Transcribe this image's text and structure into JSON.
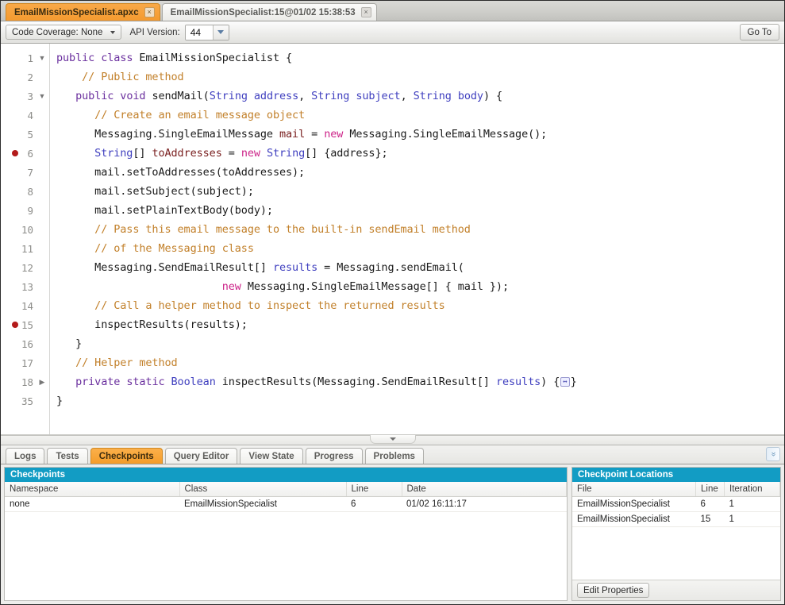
{
  "tabs": [
    {
      "label": "EmailMissionSpecialist.apxc",
      "active": true,
      "close": "×"
    },
    {
      "label": "EmailMissionSpecialist:15@01/02 15:38:53",
      "active": false,
      "close": "×"
    }
  ],
  "toolbar": {
    "code_coverage_label": "Code Coverage: None",
    "api_version_label": "API Version:",
    "api_version_value": "44",
    "goto_label": "Go To"
  },
  "editor": {
    "lines": [
      {
        "num": "1",
        "fold": "down",
        "breakpoint": false,
        "tokens": [
          {
            "t": "public",
            "c": "kw"
          },
          {
            "t": " ",
            "c": "pln"
          },
          {
            "t": "class",
            "c": "kw"
          },
          {
            "t": " EmailMissionSpecialist {",
            "c": "pln"
          }
        ]
      },
      {
        "num": "2",
        "fold": "",
        "breakpoint": false,
        "tokens": [
          {
            "t": "    // Public method",
            "c": "cmt"
          }
        ]
      },
      {
        "num": "3",
        "fold": "down",
        "breakpoint": false,
        "tokens": [
          {
            "t": "   ",
            "c": "pln"
          },
          {
            "t": "public",
            "c": "kw"
          },
          {
            "t": " ",
            "c": "pln"
          },
          {
            "t": "void",
            "c": "kw"
          },
          {
            "t": " sendMail(",
            "c": "pln"
          },
          {
            "t": "String",
            "c": "typ"
          },
          {
            "t": " ",
            "c": "pln"
          },
          {
            "t": "address",
            "c": "typ"
          },
          {
            "t": ", ",
            "c": "pln"
          },
          {
            "t": "String",
            "c": "typ"
          },
          {
            "t": " ",
            "c": "pln"
          },
          {
            "t": "subject",
            "c": "typ"
          },
          {
            "t": ", ",
            "c": "pln"
          },
          {
            "t": "String",
            "c": "typ"
          },
          {
            "t": " ",
            "c": "pln"
          },
          {
            "t": "body",
            "c": "typ"
          },
          {
            "t": ") {",
            "c": "pln"
          }
        ]
      },
      {
        "num": "4",
        "fold": "",
        "breakpoint": false,
        "tokens": [
          {
            "t": "      // Create an email message object",
            "c": "cmt"
          }
        ]
      },
      {
        "num": "5",
        "fold": "",
        "breakpoint": false,
        "tokens": [
          {
            "t": "      Messaging.SingleEmailMessage ",
            "c": "pln"
          },
          {
            "t": "mail",
            "c": "var"
          },
          {
            "t": " = ",
            "c": "pln"
          },
          {
            "t": "new",
            "c": "new"
          },
          {
            "t": " Messaging.SingleEmailMessage();",
            "c": "pln"
          }
        ]
      },
      {
        "num": "6",
        "fold": "",
        "breakpoint": true,
        "tokens": [
          {
            "t": "      ",
            "c": "pln"
          },
          {
            "t": "String",
            "c": "typ"
          },
          {
            "t": "[] ",
            "c": "pln"
          },
          {
            "t": "toAddresses",
            "c": "var"
          },
          {
            "t": " = ",
            "c": "pln"
          },
          {
            "t": "new",
            "c": "new"
          },
          {
            "t": " ",
            "c": "pln"
          },
          {
            "t": "String",
            "c": "typ"
          },
          {
            "t": "[] {address};",
            "c": "pln"
          }
        ]
      },
      {
        "num": "7",
        "fold": "",
        "breakpoint": false,
        "tokens": [
          {
            "t": "      mail.setToAddresses(toAddresses);",
            "c": "pln"
          }
        ]
      },
      {
        "num": "8",
        "fold": "",
        "breakpoint": false,
        "tokens": [
          {
            "t": "      mail.setSubject(subject);",
            "c": "pln"
          }
        ]
      },
      {
        "num": "9",
        "fold": "",
        "breakpoint": false,
        "tokens": [
          {
            "t": "      mail.setPlainTextBody(body);",
            "c": "pln"
          }
        ]
      },
      {
        "num": "10",
        "fold": "",
        "breakpoint": false,
        "tokens": [
          {
            "t": "      // Pass this email message to the built-in sendEmail method",
            "c": "cmt"
          }
        ]
      },
      {
        "num": "11",
        "fold": "",
        "breakpoint": false,
        "tokens": [
          {
            "t": "      // of the Messaging class",
            "c": "cmt"
          }
        ]
      },
      {
        "num": "12",
        "fold": "",
        "breakpoint": false,
        "tokens": [
          {
            "t": "      Messaging.SendEmailResult[] ",
            "c": "pln"
          },
          {
            "t": "results",
            "c": "typ"
          },
          {
            "t": " = Messaging.sendEmail(",
            "c": "pln"
          }
        ]
      },
      {
        "num": "13",
        "fold": "",
        "breakpoint": false,
        "tokens": [
          {
            "t": "                          ",
            "c": "pln"
          },
          {
            "t": "new",
            "c": "new"
          },
          {
            "t": " Messaging.SingleEmailMessage[] { mail });",
            "c": "pln"
          }
        ]
      },
      {
        "num": "14",
        "fold": "",
        "breakpoint": false,
        "tokens": [
          {
            "t": "      // Call a helper method to inspect the returned results",
            "c": "cmt"
          }
        ]
      },
      {
        "num": "15",
        "fold": "",
        "breakpoint": true,
        "tokens": [
          {
            "t": "      inspectResults(results);",
            "c": "pln"
          }
        ]
      },
      {
        "num": "16",
        "fold": "",
        "breakpoint": false,
        "tokens": [
          {
            "t": "   }",
            "c": "pln"
          }
        ]
      },
      {
        "num": "17",
        "fold": "",
        "breakpoint": false,
        "tokens": [
          {
            "t": "   // Helper method",
            "c": "cmt"
          }
        ]
      },
      {
        "num": "18",
        "fold": "right",
        "breakpoint": false,
        "tokens": [
          {
            "t": "   ",
            "c": "pln"
          },
          {
            "t": "private",
            "c": "kw"
          },
          {
            "t": " ",
            "c": "pln"
          },
          {
            "t": "static",
            "c": "kw"
          },
          {
            "t": " ",
            "c": "pln"
          },
          {
            "t": "Boolean",
            "c": "typ"
          },
          {
            "t": " inspectResults(Messaging.SendEmailResult[] ",
            "c": "pln"
          },
          {
            "t": "results",
            "c": "typ"
          },
          {
            "t": ") {",
            "c": "pln"
          },
          {
            "t": "↔",
            "c": "badge"
          },
          {
            "t": "}",
            "c": "pln"
          }
        ]
      },
      {
        "num": "35",
        "fold": "",
        "breakpoint": false,
        "tokens": [
          {
            "t": "}",
            "c": "pln"
          }
        ]
      }
    ]
  },
  "bottom_tabs": [
    {
      "label": "Logs",
      "active": false
    },
    {
      "label": "Tests",
      "active": false
    },
    {
      "label": "Checkpoints",
      "active": true
    },
    {
      "label": "Query Editor",
      "active": false
    },
    {
      "label": "View State",
      "active": false
    },
    {
      "label": "Progress",
      "active": false
    },
    {
      "label": "Problems",
      "active": false
    }
  ],
  "expand_icon": "»",
  "checkpoints_pane": {
    "title": "Checkpoints",
    "columns": [
      "Namespace",
      "Class",
      "Line",
      "Date"
    ],
    "rows": [
      {
        "namespace": "none",
        "class": "EmailMissionSpecialist",
        "line": "6",
        "date": "01/02 16:11:17"
      }
    ]
  },
  "locations_pane": {
    "title": "Checkpoint Locations",
    "columns": [
      "File",
      "Line",
      "Iteration"
    ],
    "rows": [
      {
        "file": "EmailMissionSpecialist",
        "line": "6",
        "iteration": "1"
      },
      {
        "file": "EmailMissionSpecialist",
        "line": "15",
        "iteration": "1"
      }
    ],
    "edit_properties_label": "Edit Properties"
  },
  "colors": {
    "accent_orange": "#f49c2a",
    "pane_title_blue": "#129cc4",
    "breakpoint_red": "#b31b1b",
    "keyword_purple": "#6a2f9e",
    "type_blue": "#3f3fbf",
    "comment_tan": "#c2802a",
    "new_magenta": "#cc2288"
  }
}
